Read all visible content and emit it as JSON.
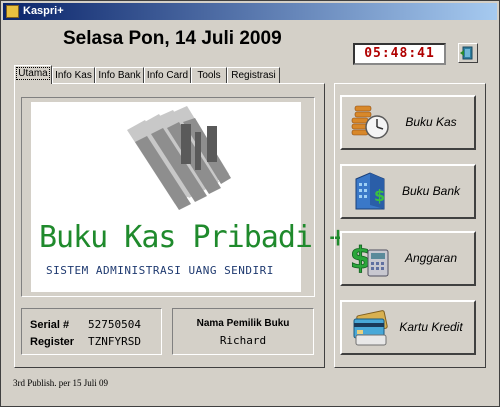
{
  "window": {
    "title": "Kaspri+"
  },
  "header": {
    "date": "Selasa Pon, 14 Juli 2009",
    "clock": "05:48:41"
  },
  "tabs": [
    "Utama",
    "Info Kas",
    "Info Bank",
    "Info Card",
    "Tools",
    "Registrasi"
  ],
  "logo": {
    "title": "Buku Kas Pribadi +",
    "subtitle": "SISTEM ADMINISTRASI UANG SENDIRI"
  },
  "registration": {
    "serial_label": "Serial #",
    "serial_value": "52750504",
    "register_label": "Register",
    "register_value": "TZNFYRSD"
  },
  "owner": {
    "label": "Nama Pemilik Buku",
    "name": "Richard"
  },
  "nav": [
    {
      "label": "Buku Kas",
      "icon": "money-clock-icon"
    },
    {
      "label": "Buku Bank",
      "icon": "bank-building-icon"
    },
    {
      "label": "Anggaran",
      "icon": "dollar-calculator-icon"
    },
    {
      "label": "Kartu Kredit",
      "icon": "credit-card-icon"
    }
  ],
  "footer": "3rd Publish. per  15 Juli 09",
  "colors": {
    "logo_green": "#1f8a2c",
    "clock_red": "#b00000",
    "titlebar": "#0a246a"
  }
}
